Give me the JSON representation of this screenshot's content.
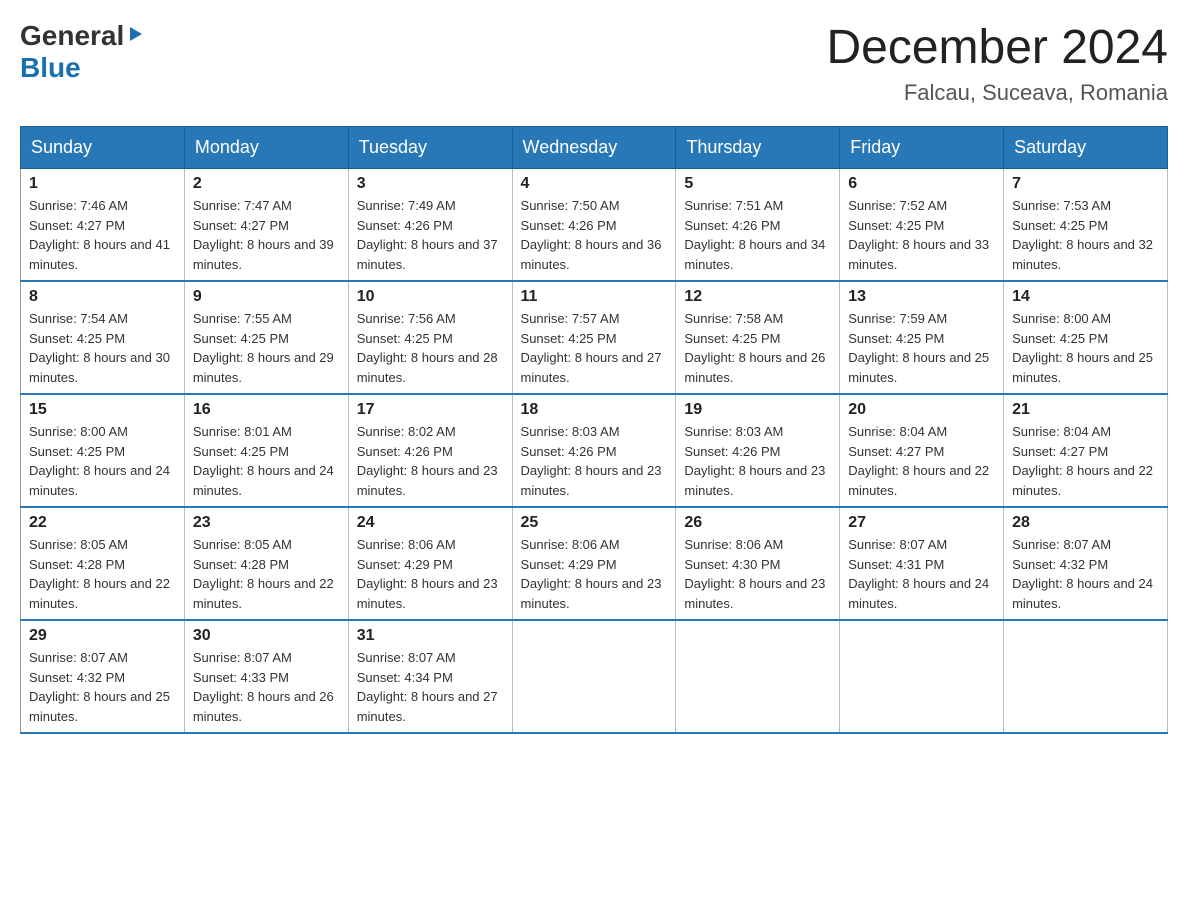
{
  "logo": {
    "general": "General",
    "blue": "Blue",
    "triangle": "▶"
  },
  "title": "December 2024",
  "subtitle": "Falcau, Suceava, Romania",
  "days_of_week": [
    "Sunday",
    "Monday",
    "Tuesday",
    "Wednesday",
    "Thursday",
    "Friday",
    "Saturday"
  ],
  "weeks": [
    [
      {
        "day": "1",
        "sunrise": "7:46 AM",
        "sunset": "4:27 PM",
        "daylight": "8 hours and 41 minutes."
      },
      {
        "day": "2",
        "sunrise": "7:47 AM",
        "sunset": "4:27 PM",
        "daylight": "8 hours and 39 minutes."
      },
      {
        "day": "3",
        "sunrise": "7:49 AM",
        "sunset": "4:26 PM",
        "daylight": "8 hours and 37 minutes."
      },
      {
        "day": "4",
        "sunrise": "7:50 AM",
        "sunset": "4:26 PM",
        "daylight": "8 hours and 36 minutes."
      },
      {
        "day": "5",
        "sunrise": "7:51 AM",
        "sunset": "4:26 PM",
        "daylight": "8 hours and 34 minutes."
      },
      {
        "day": "6",
        "sunrise": "7:52 AM",
        "sunset": "4:25 PM",
        "daylight": "8 hours and 33 minutes."
      },
      {
        "day": "7",
        "sunrise": "7:53 AM",
        "sunset": "4:25 PM",
        "daylight": "8 hours and 32 minutes."
      }
    ],
    [
      {
        "day": "8",
        "sunrise": "7:54 AM",
        "sunset": "4:25 PM",
        "daylight": "8 hours and 30 minutes."
      },
      {
        "day": "9",
        "sunrise": "7:55 AM",
        "sunset": "4:25 PM",
        "daylight": "8 hours and 29 minutes."
      },
      {
        "day": "10",
        "sunrise": "7:56 AM",
        "sunset": "4:25 PM",
        "daylight": "8 hours and 28 minutes."
      },
      {
        "day": "11",
        "sunrise": "7:57 AM",
        "sunset": "4:25 PM",
        "daylight": "8 hours and 27 minutes."
      },
      {
        "day": "12",
        "sunrise": "7:58 AM",
        "sunset": "4:25 PM",
        "daylight": "8 hours and 26 minutes."
      },
      {
        "day": "13",
        "sunrise": "7:59 AM",
        "sunset": "4:25 PM",
        "daylight": "8 hours and 25 minutes."
      },
      {
        "day": "14",
        "sunrise": "8:00 AM",
        "sunset": "4:25 PM",
        "daylight": "8 hours and 25 minutes."
      }
    ],
    [
      {
        "day": "15",
        "sunrise": "8:00 AM",
        "sunset": "4:25 PM",
        "daylight": "8 hours and 24 minutes."
      },
      {
        "day": "16",
        "sunrise": "8:01 AM",
        "sunset": "4:25 PM",
        "daylight": "8 hours and 24 minutes."
      },
      {
        "day": "17",
        "sunrise": "8:02 AM",
        "sunset": "4:26 PM",
        "daylight": "8 hours and 23 minutes."
      },
      {
        "day": "18",
        "sunrise": "8:03 AM",
        "sunset": "4:26 PM",
        "daylight": "8 hours and 23 minutes."
      },
      {
        "day": "19",
        "sunrise": "8:03 AM",
        "sunset": "4:26 PM",
        "daylight": "8 hours and 23 minutes."
      },
      {
        "day": "20",
        "sunrise": "8:04 AM",
        "sunset": "4:27 PM",
        "daylight": "8 hours and 22 minutes."
      },
      {
        "day": "21",
        "sunrise": "8:04 AM",
        "sunset": "4:27 PM",
        "daylight": "8 hours and 22 minutes."
      }
    ],
    [
      {
        "day": "22",
        "sunrise": "8:05 AM",
        "sunset": "4:28 PM",
        "daylight": "8 hours and 22 minutes."
      },
      {
        "day": "23",
        "sunrise": "8:05 AM",
        "sunset": "4:28 PM",
        "daylight": "8 hours and 22 minutes."
      },
      {
        "day": "24",
        "sunrise": "8:06 AM",
        "sunset": "4:29 PM",
        "daylight": "8 hours and 23 minutes."
      },
      {
        "day": "25",
        "sunrise": "8:06 AM",
        "sunset": "4:29 PM",
        "daylight": "8 hours and 23 minutes."
      },
      {
        "day": "26",
        "sunrise": "8:06 AM",
        "sunset": "4:30 PM",
        "daylight": "8 hours and 23 minutes."
      },
      {
        "day": "27",
        "sunrise": "8:07 AM",
        "sunset": "4:31 PM",
        "daylight": "8 hours and 24 minutes."
      },
      {
        "day": "28",
        "sunrise": "8:07 AM",
        "sunset": "4:32 PM",
        "daylight": "8 hours and 24 minutes."
      }
    ],
    [
      {
        "day": "29",
        "sunrise": "8:07 AM",
        "sunset": "4:32 PM",
        "daylight": "8 hours and 25 minutes."
      },
      {
        "day": "30",
        "sunrise": "8:07 AM",
        "sunset": "4:33 PM",
        "daylight": "8 hours and 26 minutes."
      },
      {
        "day": "31",
        "sunrise": "8:07 AM",
        "sunset": "4:34 PM",
        "daylight": "8 hours and 27 minutes."
      },
      null,
      null,
      null,
      null
    ]
  ]
}
